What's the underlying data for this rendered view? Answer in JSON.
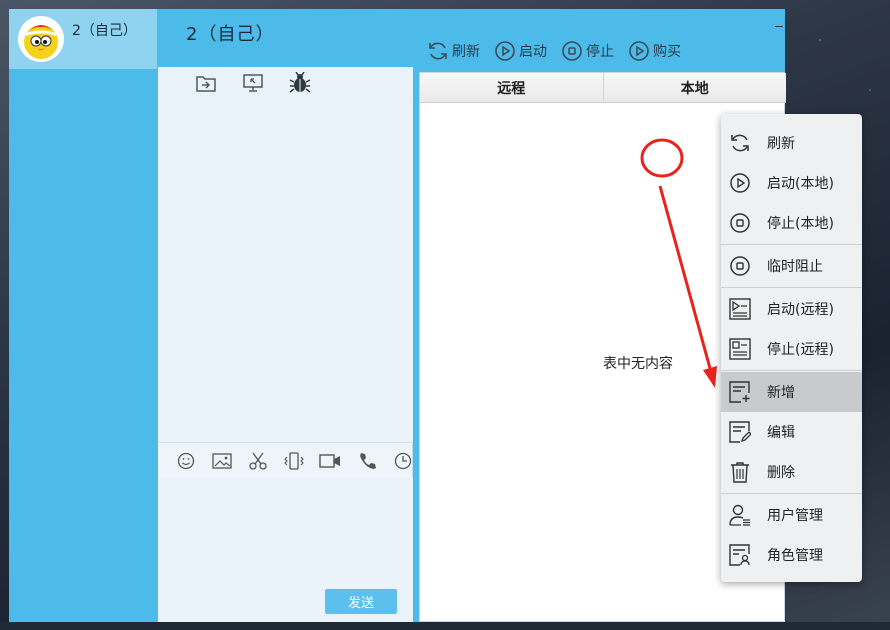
{
  "contact": {
    "name": "2（自己）"
  },
  "chat": {
    "title": "2（自己）",
    "toolbar_icons": [
      "folder-transfer-icon",
      "screen-share-icon",
      "bug-icon"
    ],
    "input_icons": [
      "emoji-icon",
      "image-icon",
      "scissors-icon",
      "shake-icon",
      "video-icon",
      "phone-icon",
      "clock-icon"
    ],
    "send_label": "发送"
  },
  "main_toolbar": {
    "refresh": "刷新",
    "start": "启动",
    "stop": "停止",
    "buy": "购买"
  },
  "table": {
    "columns": [
      "远程",
      "本地"
    ],
    "empty_text": "表中无内容"
  },
  "context_menu": {
    "items": [
      {
        "label": "刷新",
        "icon": "refresh-icon"
      },
      {
        "label": "启动(本地)",
        "icon": "play-circle-icon"
      },
      {
        "label": "停止(本地)",
        "icon": "stop-circle-icon"
      },
      {
        "label": "临时阻止",
        "icon": "block-circle-icon"
      },
      {
        "label": "启动(远程)",
        "icon": "remote-start-icon"
      },
      {
        "label": "停止(远程)",
        "icon": "remote-stop-icon"
      },
      {
        "label": "新增",
        "icon": "add-note-icon"
      },
      {
        "label": "编辑",
        "icon": "edit-note-icon"
      },
      {
        "label": "删除",
        "icon": "trash-icon"
      },
      {
        "label": "用户管理",
        "icon": "user-manage-icon"
      },
      {
        "label": "角色管理",
        "icon": "role-manage-icon"
      }
    ],
    "highlighted": "新增"
  },
  "colors": {
    "app_blue": "#4dbbea",
    "contact_selected": "#8fd3f0",
    "annotation_red": "#e8231c",
    "menu_highlight": "#c8cacd"
  }
}
